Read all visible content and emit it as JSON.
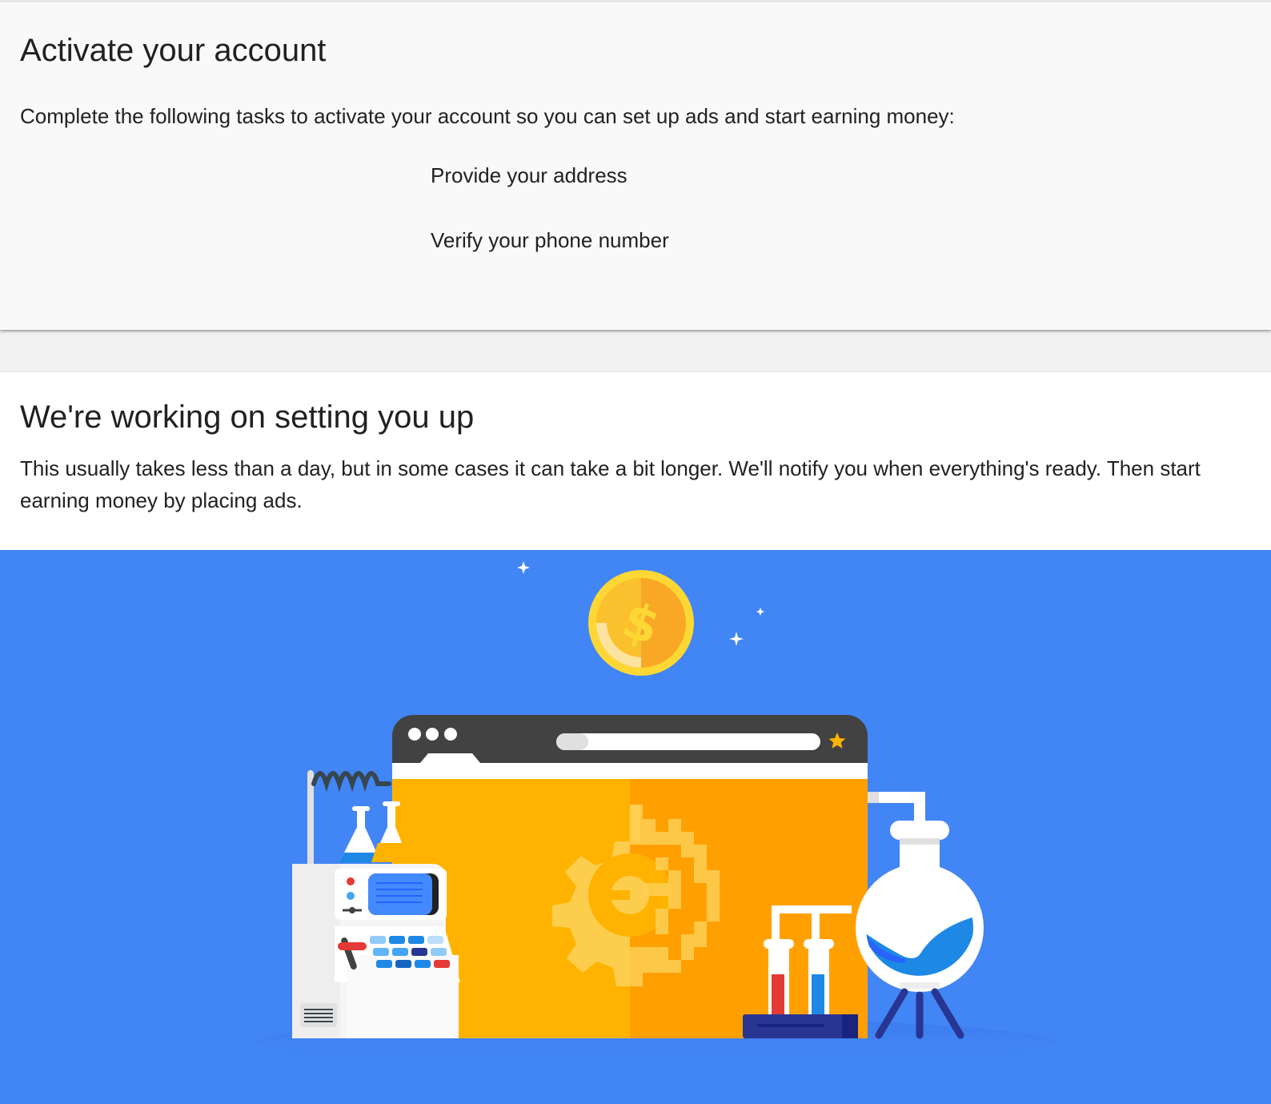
{
  "activate": {
    "title": "Activate your account",
    "description": "Complete the following tasks to activate your account so you can set up ads and start earning money:",
    "tasks": [
      {
        "label": "Provide your address"
      },
      {
        "label": "Verify your phone number"
      }
    ]
  },
  "setup": {
    "title": "We're working on setting you up",
    "description": "This usually takes less than a day, but in some cases it can take a bit longer. We'll notify you when everything's ready. Then start earning money by placing ads."
  },
  "illustration": {
    "name": "setup-in-progress-illustration",
    "icons": [
      "coin-icon",
      "browser-window",
      "gear-icon",
      "lab-machine",
      "test-tubes",
      "round-flask",
      "star-icon",
      "sparkle-icon"
    ],
    "colors": {
      "background": "#4285f4",
      "browser_left": "#ffb300",
      "browser_right": "#ffa000",
      "coin": "#fbc02d",
      "frame": "#424242"
    }
  }
}
